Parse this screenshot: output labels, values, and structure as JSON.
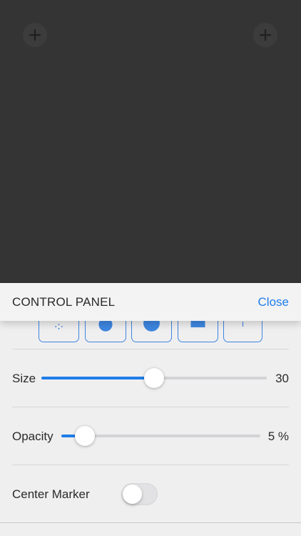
{
  "canvas": {
    "left_button_icon": "plus-icon",
    "right_button_icon": "plus-icon"
  },
  "panel": {
    "title": "CONTROL PANEL",
    "close_label": "Close",
    "shape_buttons": [
      {
        "icon": "cross-dots-icon"
      },
      {
        "icon": "small-dot-icon"
      },
      {
        "icon": "large-dot-icon"
      },
      {
        "icon": "square-icon"
      },
      {
        "icon": "crosshair-icon"
      }
    ],
    "size": {
      "label": "Size",
      "value": "30",
      "fraction": 0.5
    },
    "opacity": {
      "label": "Opacity",
      "value": "5 %",
      "fraction": 0.12
    },
    "center_marker": {
      "label": "Center Marker",
      "enabled": false
    }
  },
  "colors": {
    "accent": "#1f7de8",
    "background": "#343434",
    "panel": "#efeff0"
  }
}
